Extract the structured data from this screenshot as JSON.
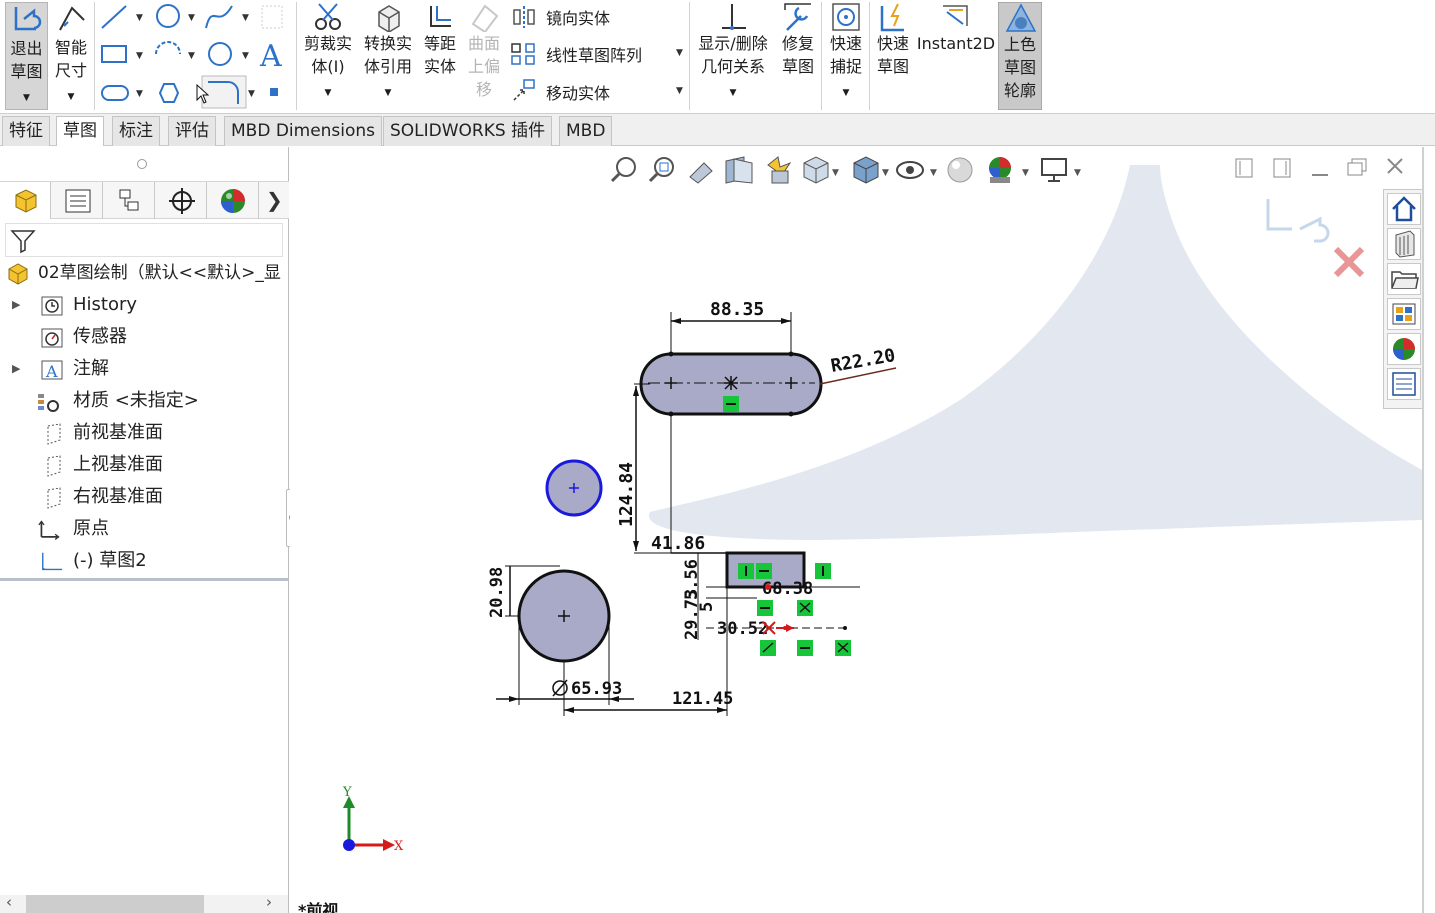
{
  "ribbon": {
    "exit_sketch": [
      "退出",
      "草图"
    ],
    "smart_dimension": [
      "智能",
      "尺寸"
    ],
    "trim": [
      "剪裁实",
      "体(I)"
    ],
    "convert": [
      "转换实",
      "体引用"
    ],
    "offset": [
      "等距",
      "实体"
    ],
    "surface_offset": [
      "曲面",
      "上偏",
      "移"
    ],
    "mirror": "镜向实体",
    "linear_pattern": "线性草图阵列",
    "move": "移动实体",
    "display_relations": [
      "显示/删除",
      "几何关系"
    ],
    "repair": [
      "修复",
      "草图"
    ],
    "quick_snaps": [
      "快速",
      "捕捉"
    ],
    "rapid_sketch": [
      "快速",
      "草图"
    ],
    "instant2d": "Instant2D",
    "shaded_contours": [
      "上色",
      "草图",
      "轮廓"
    ]
  },
  "tabs": [
    {
      "label": "特征"
    },
    {
      "label": "草图",
      "active": true
    },
    {
      "label": "标注"
    },
    {
      "label": "评估"
    },
    {
      "label": "MBD Dimensions"
    },
    {
      "label": "SOLIDWORKS 插件"
    },
    {
      "label": "MBD"
    }
  ],
  "tree": {
    "root": "02草图绘制（默认<<默认>_显",
    "items": [
      {
        "label": "History",
        "icon": "history-icon",
        "expandable": true
      },
      {
        "label": "传感器",
        "icon": "sensor-icon",
        "expandable": false
      },
      {
        "label": "注解",
        "icon": "annotation-icon",
        "expandable": true
      },
      {
        "label": "材质 <未指定>",
        "icon": "material-icon",
        "expandable": false
      },
      {
        "label": "前视基准面",
        "icon": "plane-icon",
        "expandable": false
      },
      {
        "label": "上视基准面",
        "icon": "plane-icon",
        "expandable": false
      },
      {
        "label": "右视基准面",
        "icon": "plane-icon",
        "expandable": false
      },
      {
        "label": "原点",
        "icon": "origin-icon",
        "expandable": false
      },
      {
        "label": "(-) 草图2",
        "icon": "sketch-icon",
        "expandable": false
      }
    ]
  },
  "dimensions": {
    "slot_length": "88.35",
    "slot_radius": "R22.20",
    "vertical_distance": "124.84",
    "horizontal_distance": "41.86",
    "circle_diameter": "20.98",
    "circle_d_text": "65.93",
    "bottom_width": "121.45",
    "rect_a": "5.56",
    "rect_b": "29.73",
    "rect_c": "5",
    "rect_d": "30.52",
    "rect_e": "68.38"
  },
  "triad": {
    "y": "Y",
    "x": "X"
  },
  "view_label": "*前视",
  "colors": {
    "sketch_fill": "#a9aac8",
    "selected_blue": "#1a1adc",
    "relation_green": "#17c53a",
    "accent": "#1f4e9a"
  }
}
